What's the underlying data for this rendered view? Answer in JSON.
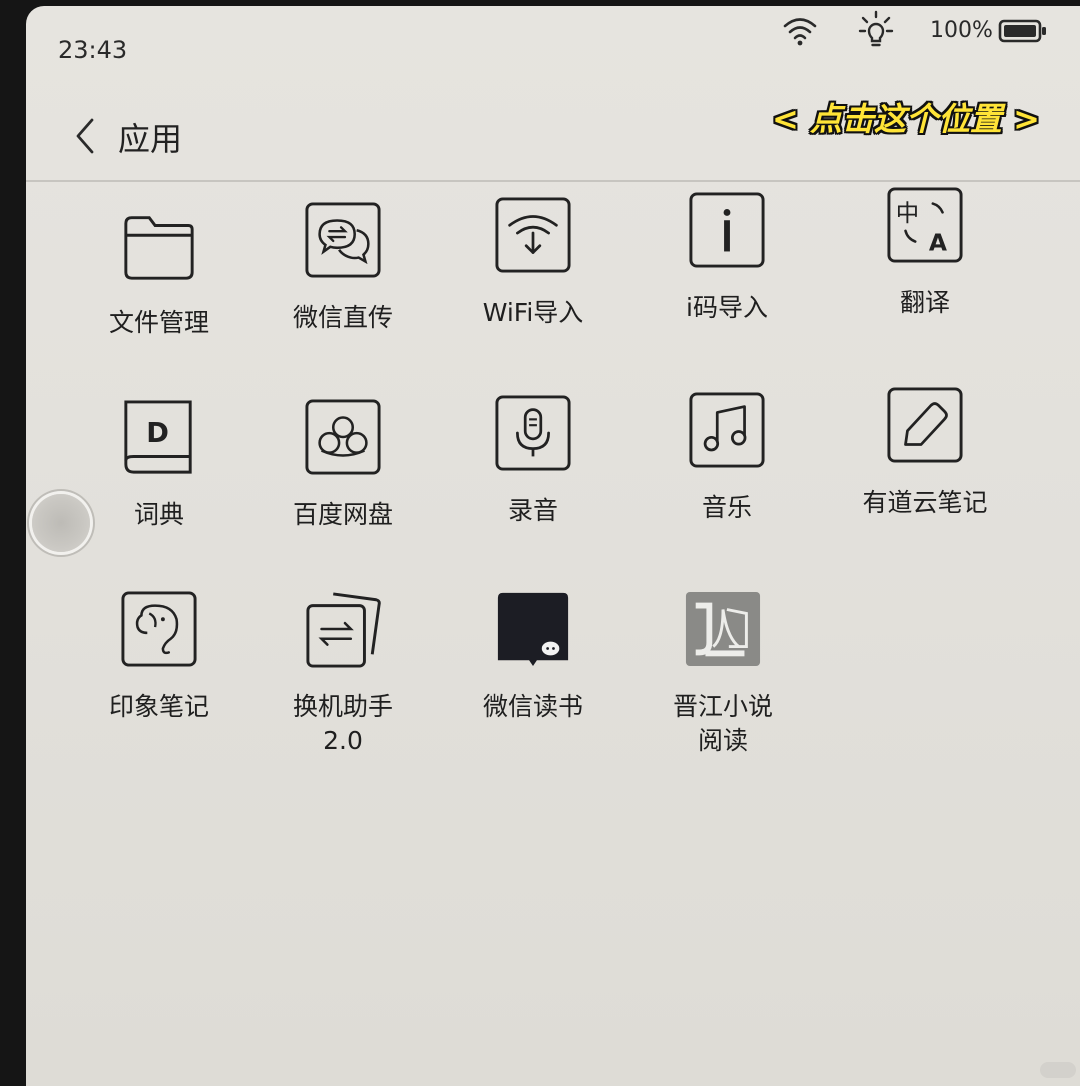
{
  "status": {
    "time": "23:43",
    "battery": "100%"
  },
  "header": {
    "title": "应用"
  },
  "annotation": "< 点击这个位置 >",
  "apps": [
    {
      "label": "文件管理",
      "icon": "folder-icon"
    },
    {
      "label": "微信直传",
      "icon": "wechat-transfer-icon"
    },
    {
      "label": "WiFi导入",
      "icon": "wifi-import-icon"
    },
    {
      "label": "i码导入",
      "icon": "i-code-icon"
    },
    {
      "label": "翻译",
      "icon": "translate-icon"
    },
    {
      "label": "词典",
      "icon": "dictionary-icon"
    },
    {
      "label": "百度网盘",
      "icon": "baidu-netdisk-icon"
    },
    {
      "label": "录音",
      "icon": "microphone-icon"
    },
    {
      "label": "音乐",
      "icon": "music-note-icon"
    },
    {
      "label": "有道云笔记",
      "icon": "pencil-icon"
    },
    {
      "label": "印象笔记",
      "icon": "evernote-elephant-icon"
    },
    {
      "label": "换机助手 2.0",
      "icon": "switch-cards-icon"
    },
    {
      "label": "微信读书",
      "icon": "wechat-read-icon"
    },
    {
      "label": "晋江小说 阅读",
      "icon": "jinjiang-book-icon"
    }
  ],
  "colors": {
    "screen_bg": "#e4e2dd",
    "annotation": "#ffe437",
    "ink": "#222222"
  }
}
